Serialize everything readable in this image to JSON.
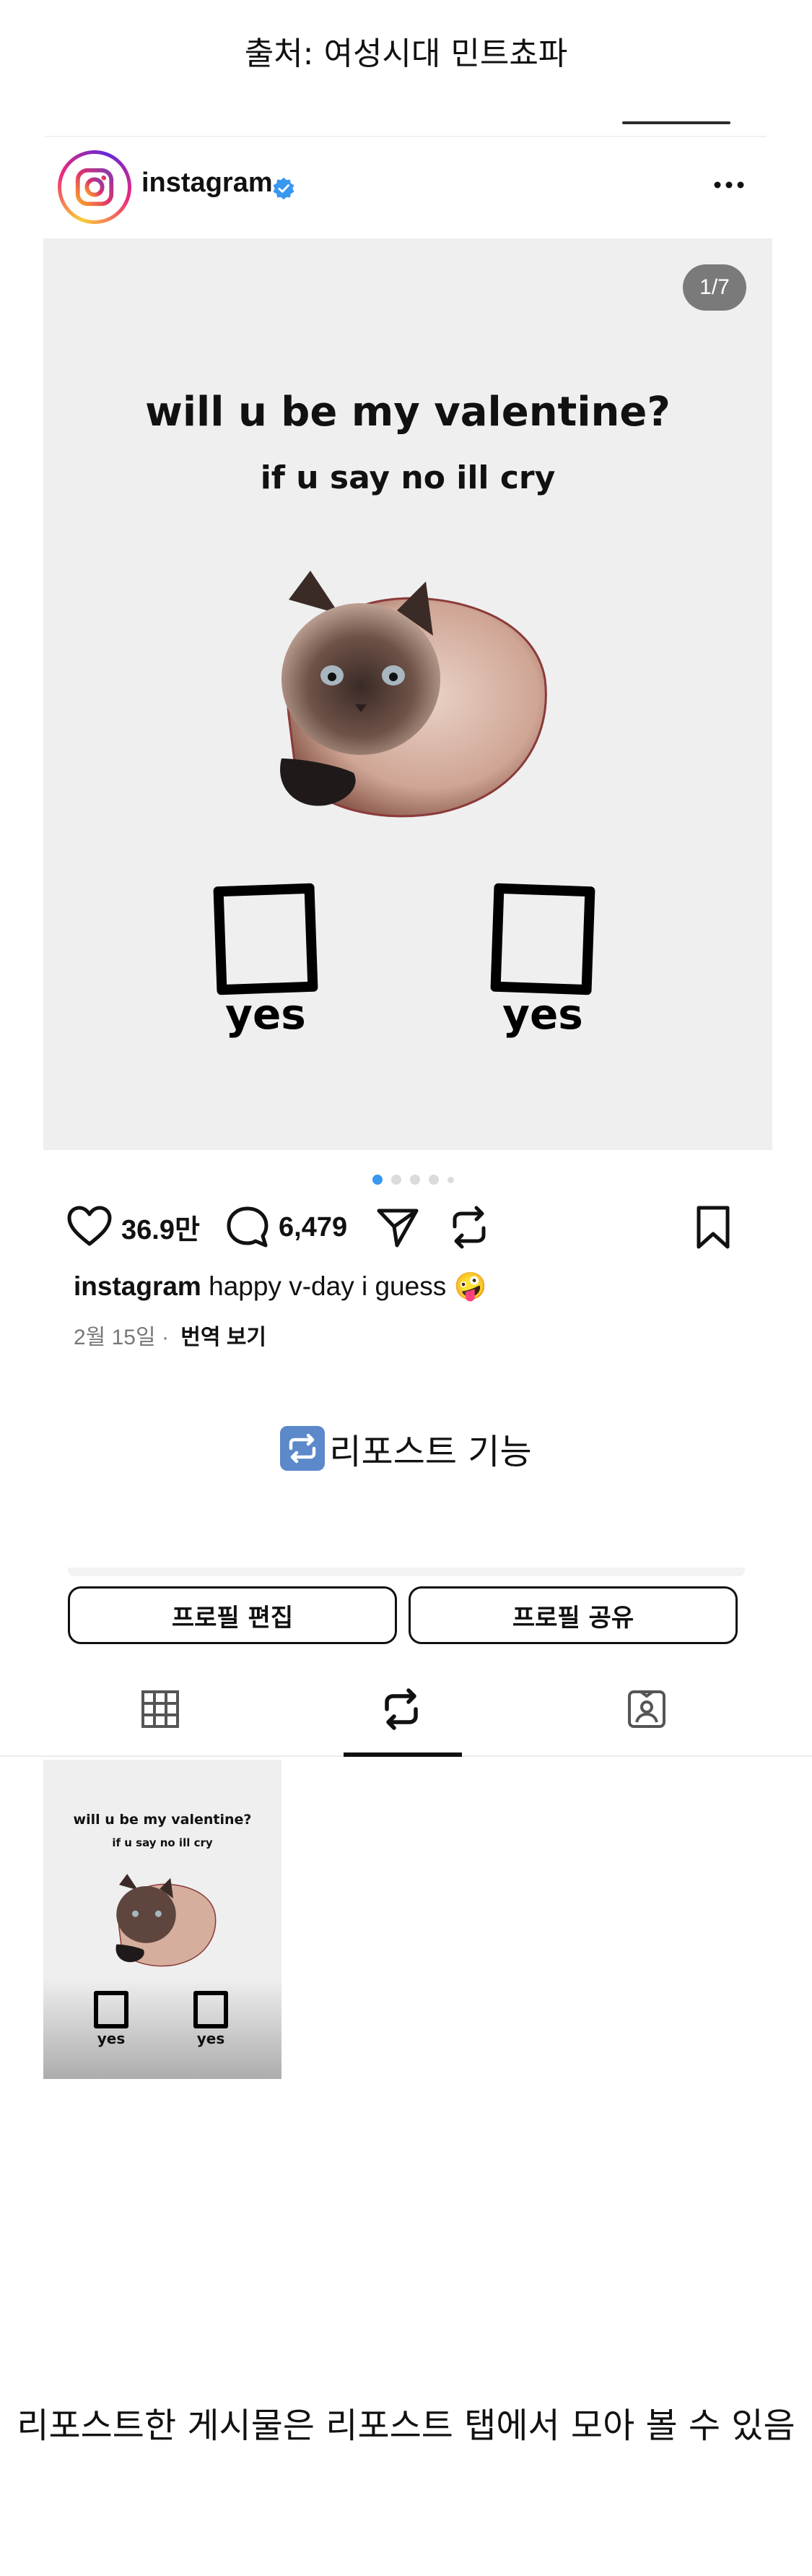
{
  "source_caption": "출처: 여성시대 민트쵸파",
  "post": {
    "username": "instagram",
    "verified": true,
    "page_indicator": "1/7",
    "image": {
      "title": "will u be my valentine?",
      "subtitle": "if u say no ill cry",
      "option_left": "yes",
      "option_right": "yes"
    },
    "carousel": {
      "total_dots": 5,
      "active_index": 0
    },
    "actions": {
      "likes": "36.9만",
      "comments": "6,479"
    },
    "caption_user": "instagram",
    "caption_text": "happy v-day i guess 🤪",
    "date": "2월 15일",
    "separator": "·",
    "translate_label": "번역 보기"
  },
  "feature_label": "리포스트 기능",
  "profile": {
    "edit_button": "프로필 편집",
    "share_button": "프로필 공유",
    "tabs": [
      "grid",
      "reposts",
      "tagged"
    ],
    "active_tab": "reposts"
  },
  "thumbnail": {
    "title": "will u be my valentine?",
    "subtitle": "if u say no ill cry",
    "option_left": "yes",
    "option_right": "yes"
  },
  "bottom_caption": "리포스트한 게시물은 리포스트 탭에서 모아 볼 수 있음",
  "colors": {
    "verified_blue": "#3897f0",
    "active_dot": "#3897f0",
    "image_background": "#efefef",
    "text": "#111111"
  },
  "icons": [
    "instagram-logo-icon",
    "verified-badge-icon",
    "more-icon",
    "heart-icon",
    "comment-icon",
    "share-icon",
    "repost-icon",
    "bookmark-icon",
    "grid-icon",
    "tagged-icon"
  ]
}
